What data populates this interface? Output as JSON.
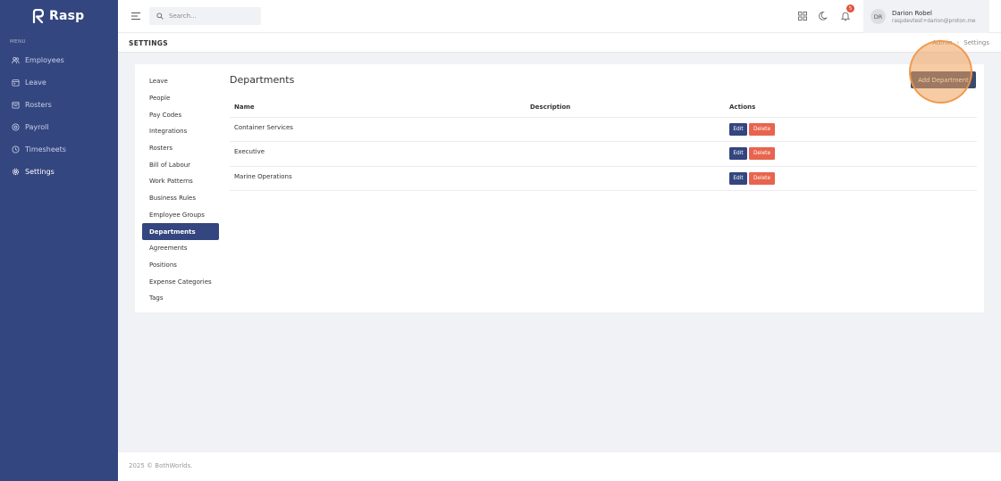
{
  "app": {
    "name": "Rasp"
  },
  "sidebar": {
    "menu_label": "MENU",
    "items": [
      {
        "label": "Employees",
        "icon": "people-icon"
      },
      {
        "label": "Leave",
        "icon": "calendar-icon"
      },
      {
        "label": "Rosters",
        "icon": "roster-icon"
      },
      {
        "label": "Payroll",
        "icon": "payroll-icon"
      },
      {
        "label": "Timesheets",
        "icon": "clock-icon"
      },
      {
        "label": "Settings",
        "icon": "gear-icon",
        "active": true
      }
    ]
  },
  "topbar": {
    "search_placeholder": "Search...",
    "notification_count": "5",
    "user": {
      "initials": "DR",
      "name": "Darion Robel",
      "email": "raspdevtest+darion@proton.me"
    }
  },
  "page": {
    "title": "SETTINGS",
    "breadcrumb": [
      "Admin",
      "Settings"
    ]
  },
  "settings_nav": {
    "items": [
      "Leave",
      "People",
      "Pay Codes",
      "Integrations",
      "Rosters",
      "Bill of Labour",
      "Work Patterns",
      "Business Rules",
      "Employee Groups",
      "Departments",
      "Agreements",
      "Positions",
      "Expense Categories",
      "Tags"
    ],
    "active": "Departments"
  },
  "departments": {
    "title": "Departments",
    "add_button": "Add Department",
    "columns": {
      "name": "Name",
      "description": "Description",
      "actions": "Actions"
    },
    "rows": [
      {
        "name": "Container Services",
        "description": ""
      },
      {
        "name": "Executive",
        "description": ""
      },
      {
        "name": "Marine Operations",
        "description": ""
      }
    ],
    "edit_label": "Edit",
    "delete_label": "Delete"
  },
  "footer": {
    "text": "2025 © BothWorlds."
  },
  "colors": {
    "sidebar": "#34467f",
    "delete": "#e8644e",
    "badge": "#e2533f",
    "highlight": "#f0a05a"
  }
}
